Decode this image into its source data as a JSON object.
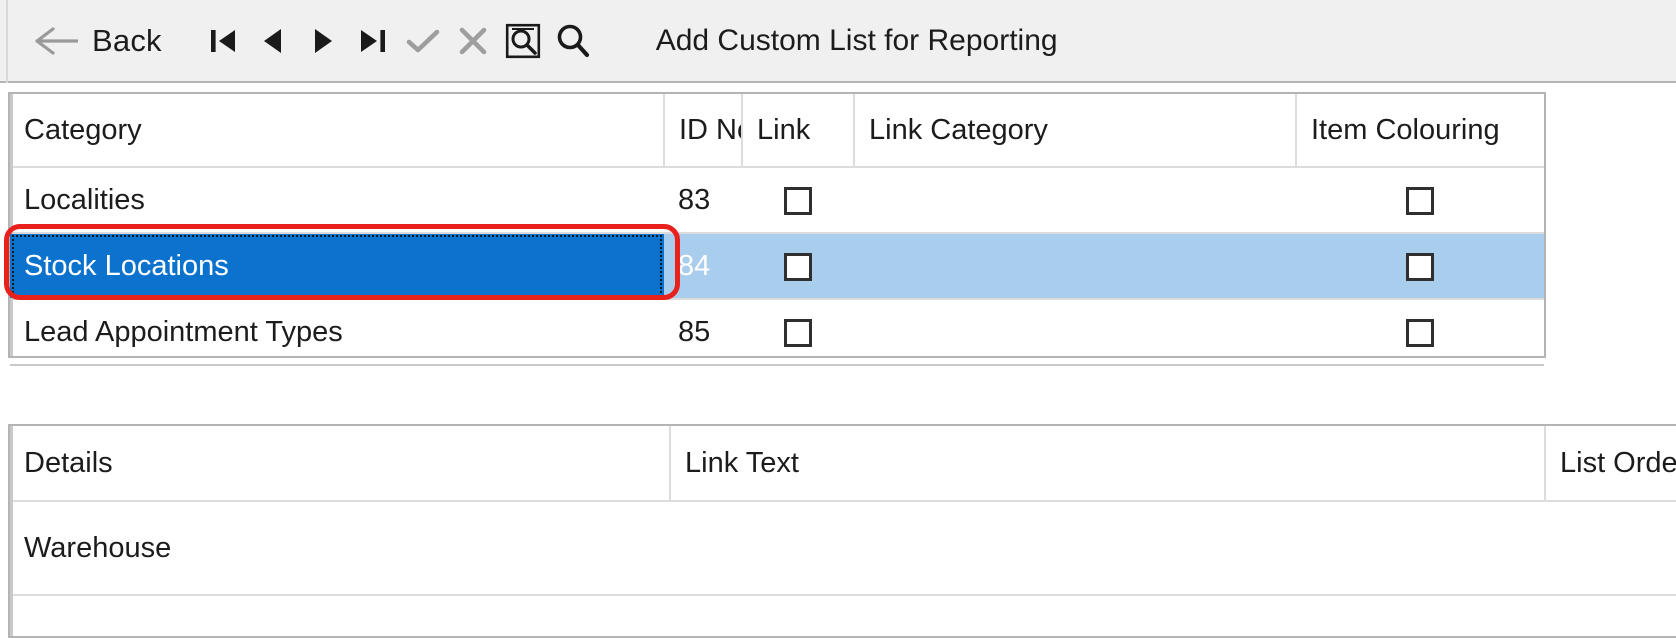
{
  "toolbar": {
    "back_label": "Back",
    "back_icon": "arrow-left-icon",
    "title": "Add Custom List for Reporting",
    "buttons": [
      {
        "name": "first-record-button",
        "icon": "skip-to-start-icon",
        "enabled": true
      },
      {
        "name": "previous-record-button",
        "icon": "triangle-left-icon",
        "enabled": true
      },
      {
        "name": "next-record-button",
        "icon": "triangle-right-icon",
        "enabled": true
      },
      {
        "name": "last-record-button",
        "icon": "skip-to-end-icon",
        "enabled": true
      },
      {
        "name": "confirm-button",
        "icon": "check-icon",
        "enabled": false
      },
      {
        "name": "cancel-button",
        "icon": "cross-icon",
        "enabled": false
      },
      {
        "name": "zoom-find-button",
        "icon": "magnifier-boxed-icon",
        "enabled": true
      },
      {
        "name": "search-button",
        "icon": "magnifier-icon",
        "enabled": true
      }
    ]
  },
  "categories_grid": {
    "columns": [
      "Category",
      "ID No",
      "Link",
      "Link Category",
      "Item Colouring"
    ],
    "rows": [
      {
        "category": "Localities",
        "id_no": "83",
        "link_checked": false,
        "link_category": "",
        "item_colouring_checked": false,
        "selected": false
      },
      {
        "category": "Stock Locations",
        "id_no": "84",
        "link_checked": false,
        "link_category": "",
        "item_colouring_checked": false,
        "selected": true
      },
      {
        "category": "Lead Appointment Types",
        "id_no": "85",
        "link_checked": false,
        "link_category": "",
        "item_colouring_checked": false,
        "selected": false
      }
    ]
  },
  "details_grid": {
    "columns": [
      "Details",
      "Link Text",
      "List Order"
    ],
    "rows": [
      {
        "details": "Warehouse",
        "link_text": "",
        "list_order": ""
      }
    ]
  },
  "annotation": {
    "name": "red-highlight-ring",
    "color": "#e8211d",
    "targets": "Stock Locations"
  },
  "colors": {
    "toolbar_background": "#f0f0f0",
    "selected_cell": "#0b72ce",
    "selected_row": "#a9cded",
    "grid_border": "#b4b4b4",
    "text": "#1c1c1c"
  }
}
